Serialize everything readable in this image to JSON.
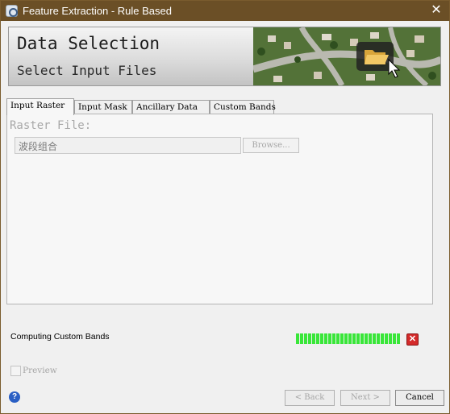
{
  "window": {
    "title": "Feature Extraction - Rule Based",
    "close_glyph": "✕",
    "colors": {
      "titlebar": "#6b4f26",
      "progress": "#39e639",
      "help": "#2a5fc4"
    }
  },
  "banner": {
    "title": "Data Selection",
    "subtitle": "Select Input Files",
    "image_icon": "open-folder-icon"
  },
  "tabs": [
    {
      "label": "Input Raster",
      "active": true
    },
    {
      "label": "Input Mask",
      "active": false
    },
    {
      "label": "Ancillary Data",
      "active": false
    },
    {
      "label": "Custom Bands",
      "active": false
    }
  ],
  "raster": {
    "label": "Raster File:",
    "value": "波段组合",
    "browse_label": "Browse..."
  },
  "status": {
    "text": "Computing Custom Bands",
    "progress_fraction": 1.0,
    "cancel_icon": "red-x-icon"
  },
  "preview": {
    "label": "Preview",
    "checked": false
  },
  "buttons": {
    "back": "< Back",
    "next": "Next >",
    "cancel": "Cancel"
  },
  "help_glyph": "?"
}
